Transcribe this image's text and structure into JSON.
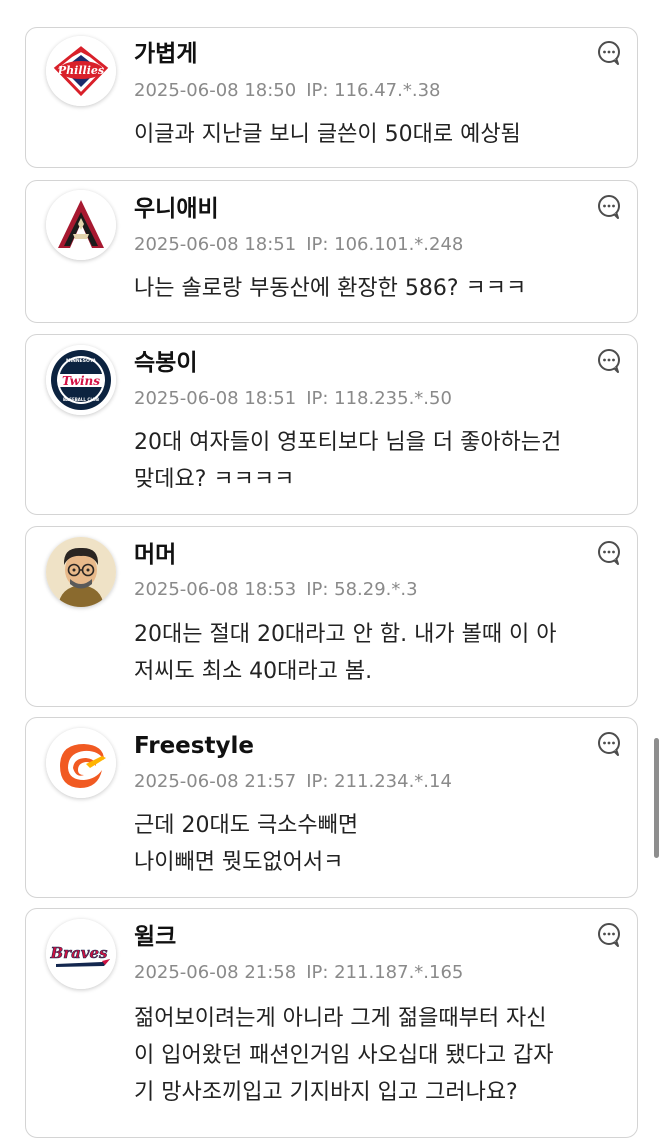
{
  "comments": [
    {
      "author": "가볍게",
      "date": "2025-06-08 18:50",
      "ip": "IP: 116.47.*.38",
      "lines": [
        "이글과 지난글 보니 글쓴이 50대로 예상됨"
      ],
      "avatar": "phillies-logo-avatar",
      "reply_icon": "reply-bubble-icon"
    },
    {
      "author": "우니애비",
      "date": "2025-06-08 18:51",
      "ip": "IP: 106.101.*.248",
      "lines": [
        "나는 솔로랑 부동산에 환장한 586? ㅋㅋㅋ"
      ],
      "avatar": "diamondbacks-logo-avatar",
      "reply_icon": "reply-bubble-icon"
    },
    {
      "author": "슥봉이",
      "date": "2025-06-08 18:51",
      "ip": "IP: 118.235.*.50",
      "lines": [
        "20대 여자들이 영포티보다 님을 더 좋아하는건",
        "맞데요? ㅋㅋㅋㅋ"
      ],
      "avatar": "twins-logo-avatar",
      "reply_icon": "reply-bubble-icon"
    },
    {
      "author": "머머",
      "date": "2025-06-08 18:53",
      "ip": "IP: 58.29.*.3",
      "lines": [
        "20대는 절대 20대라고 안 함. 내가 볼때 이 아",
        "저씨도 최소 40대라고 봄."
      ],
      "avatar": "cartoon-face-avatar",
      "reply_icon": "reply-bubble-icon"
    },
    {
      "author": "Freestyle",
      "date": "2025-06-08 21:57",
      "ip": "IP: 211.234.*.14",
      "lines": [
        "근데 20대도 극소수빼면",
        "나이빼면 뭣도없어서ㅋ"
      ],
      "avatar": "orange-swirl-logo-avatar",
      "reply_icon": "reply-bubble-icon"
    },
    {
      "author": "윌크",
      "date": "2025-06-08 21:58",
      "ip": "IP: 211.187.*.165",
      "lines": [
        "젊어보이려는게 아니라 그게 젊을때부터 자신",
        "이 입어왔던 패션인거임 사오십대 됐다고 갑자",
        "기 망사조끼입고 기지바지 입고 그러나요?"
      ],
      "avatar": "braves-logo-avatar",
      "reply_icon": "reply-bubble-icon"
    }
  ],
  "logos": {
    "phillies": "Phillies",
    "twins_top": "MINNESOTA",
    "twins": "Twins",
    "twins_bottom": "BASEBALL CLUB",
    "braves": "Braves"
  },
  "colors": {
    "card_border": "#d4d4d4",
    "meta_text": "#8a8a8a",
    "phillies_red": "#d9202a",
    "dbacks_red": "#a71930",
    "twins_navy": "#0c2340",
    "braves_red": "#ce1141",
    "freestyle_orange": "#f15a22"
  }
}
